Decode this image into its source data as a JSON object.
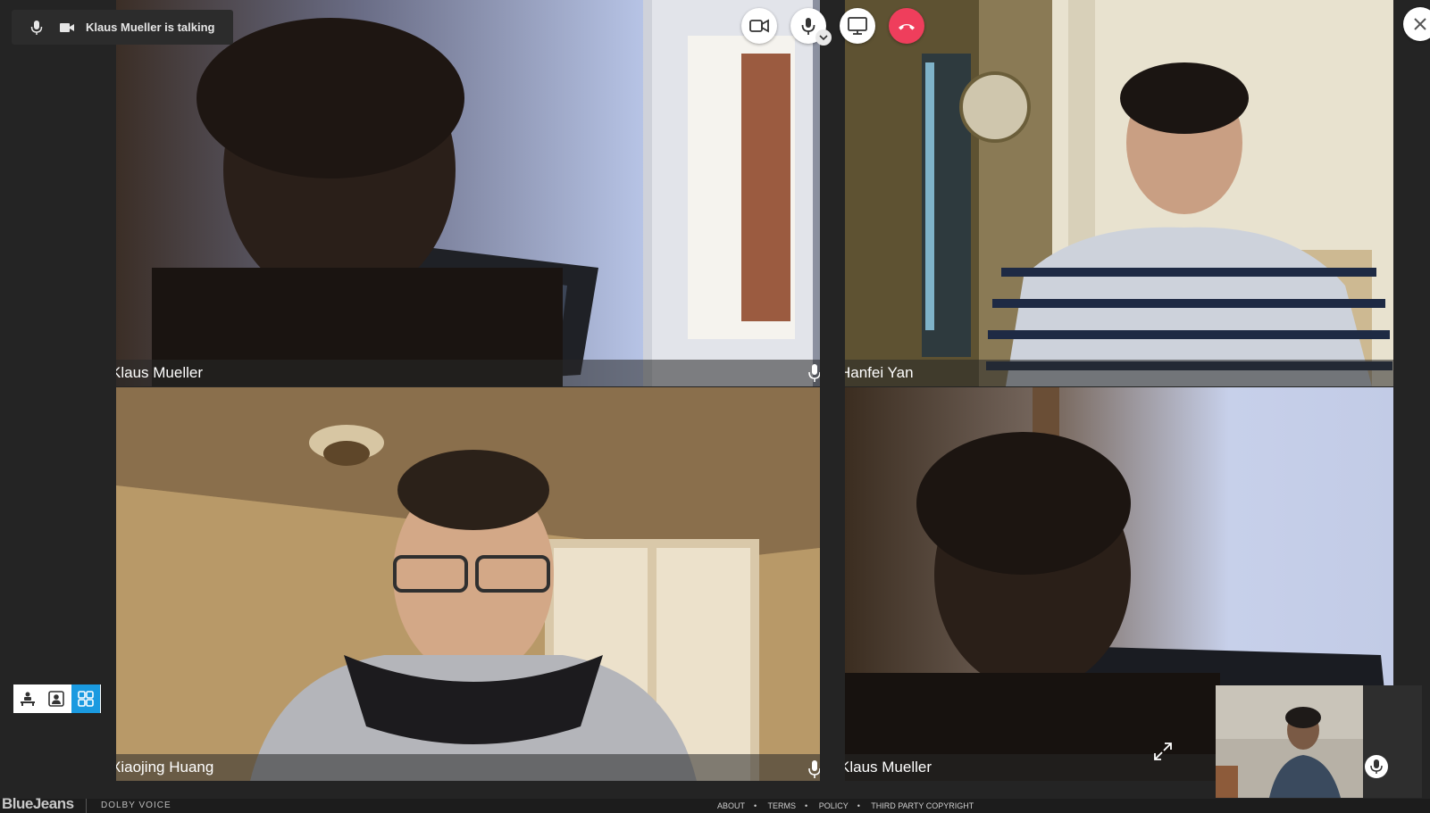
{
  "status_bar": {
    "talking_text": "Klaus Mueller is talking"
  },
  "toolbar": {
    "camera_icon": "video-camera",
    "mic_icon": "microphone",
    "screen_share_icon": "monitor",
    "leave_icon": "phone-hangup",
    "leave_color": "#ef3e5c",
    "close_icon": "close-x"
  },
  "participants": [
    {
      "name": "Klaus Mueller",
      "mic": true
    },
    {
      "name": "Hanfei Yan",
      "mic": false
    },
    {
      "name": "Xiaojing Huang",
      "mic": true
    },
    {
      "name": "Klaus Mueller",
      "mic": false
    }
  ],
  "layout_switcher": {
    "options": [
      "people-view-icon",
      "speaker-view-icon",
      "gallery-view-icon"
    ],
    "active_color": "#1a9ae0"
  },
  "footer": {
    "brand": "BlueJeans",
    "partner": "DOLBY VOICE",
    "links": [
      "ABOUT",
      "TERMS",
      "POLICY",
      "THIRD PARTY COPYRIGHT"
    ]
  }
}
